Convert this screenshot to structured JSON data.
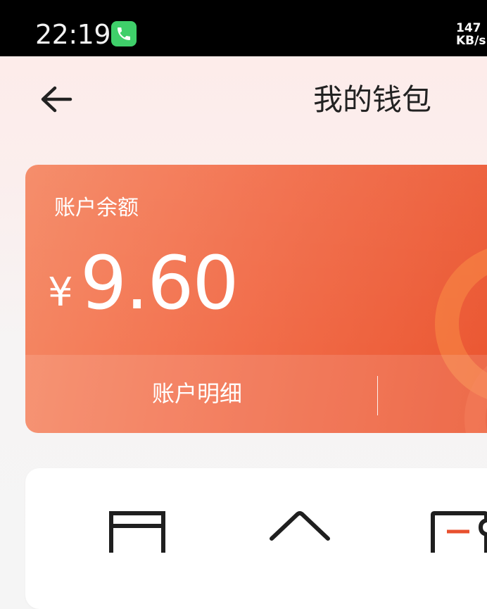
{
  "status_bar": {
    "time": "22:19",
    "call_icon": "phone-icon",
    "net_speed_value": "147",
    "net_speed_unit": "KB/s"
  },
  "header": {
    "title": "我的钱包",
    "back_icon": "arrow-left-icon"
  },
  "balance_card": {
    "label": "账户余额",
    "currency": "¥",
    "amount": "9.60",
    "footer_link": "账户明细",
    "gradient_colors": [
      "#f58864",
      "#ea5530"
    ]
  },
  "menu": {
    "icons": [
      "card-icon",
      "home-icon",
      "ticket-icon"
    ]
  }
}
